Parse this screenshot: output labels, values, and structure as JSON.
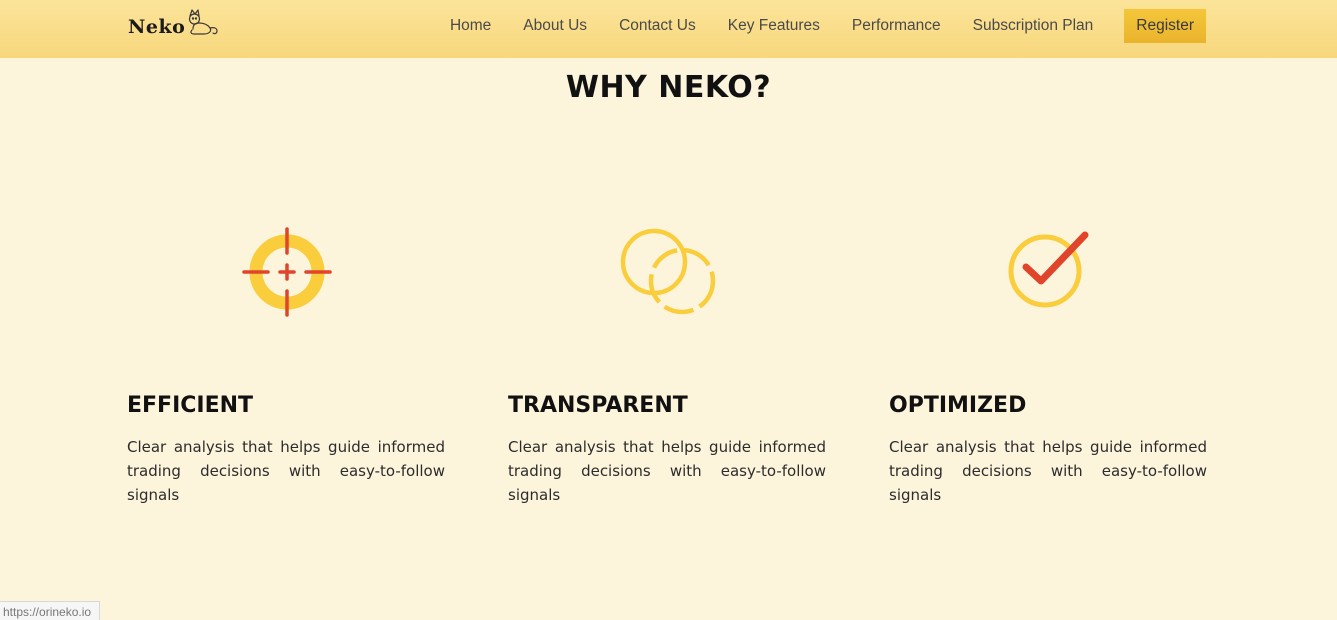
{
  "brand": {
    "name": "Neko",
    "icon": "cat-logo-icon"
  },
  "nav": {
    "links": [
      "Home",
      "About Us",
      "Contact Us",
      "Key Features",
      "Performance",
      "Subscription Plan"
    ],
    "register_label": "Register"
  },
  "section": {
    "title": "WHY NEKO?"
  },
  "features": [
    {
      "icon": "crosshair-target-icon",
      "title": "EFFICIENT",
      "description": "Clear analysis that helps guide informed trading decisions with easy-to-follow signals"
    },
    {
      "icon": "overlapping-circles-icon",
      "title": "TRANSPARENT",
      "description": "Clear analysis that helps guide informed trading decisions with easy-to-follow signals"
    },
    {
      "icon": "checkmark-circle-icon",
      "title": "OPTIMIZED",
      "description": "Clear analysis that helps guide informed trading decisions with easy-to-follow signals"
    }
  ],
  "status_bar": {
    "url": "https://orineko.io"
  },
  "colors": {
    "page_background": "#fdf4dc",
    "navbar_background": "#f8d77c",
    "register_button": "#f4c63a",
    "icon_yellow": "#f9cd3c",
    "icon_red": "#e0442a"
  }
}
